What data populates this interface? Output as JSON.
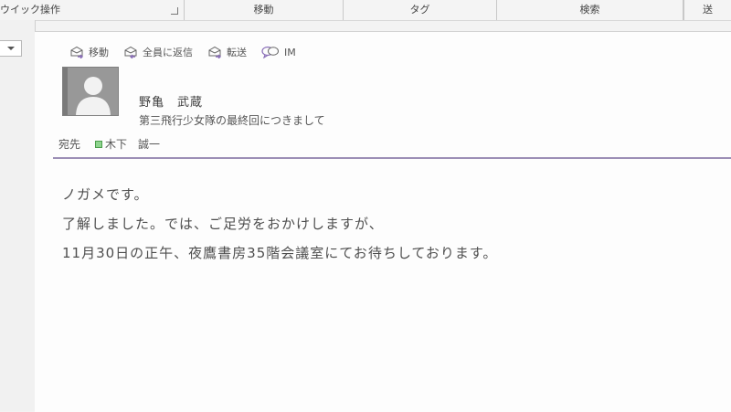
{
  "ribbon": {
    "groups": [
      "ウイック操作",
      "移動",
      "タグ",
      "検索",
      "送"
    ]
  },
  "message": {
    "actions": [
      {
        "label": "移動",
        "icon": "move-mail-icon"
      },
      {
        "label": "全員に返信",
        "icon": "reply-all-icon"
      },
      {
        "label": "転送",
        "icon": "forward-icon"
      },
      {
        "label": "IM",
        "icon": "chat-icon"
      }
    ],
    "sender": "野亀　武蔵",
    "subject": "第三飛行少女隊の最終回につきまして",
    "to_label": "宛先",
    "recipient": "木下　誠一",
    "body": [
      "ノガメです。",
      "了解しました。では、ご足労をおかけしますが、",
      "11月30日の正午、夜鷹書房35階会議室にてお待ちしております。"
    ]
  },
  "colors": {
    "header_rule": "#9c8fb6",
    "presence": "#8ed48e",
    "icon_accent": "#8a6fb8"
  }
}
